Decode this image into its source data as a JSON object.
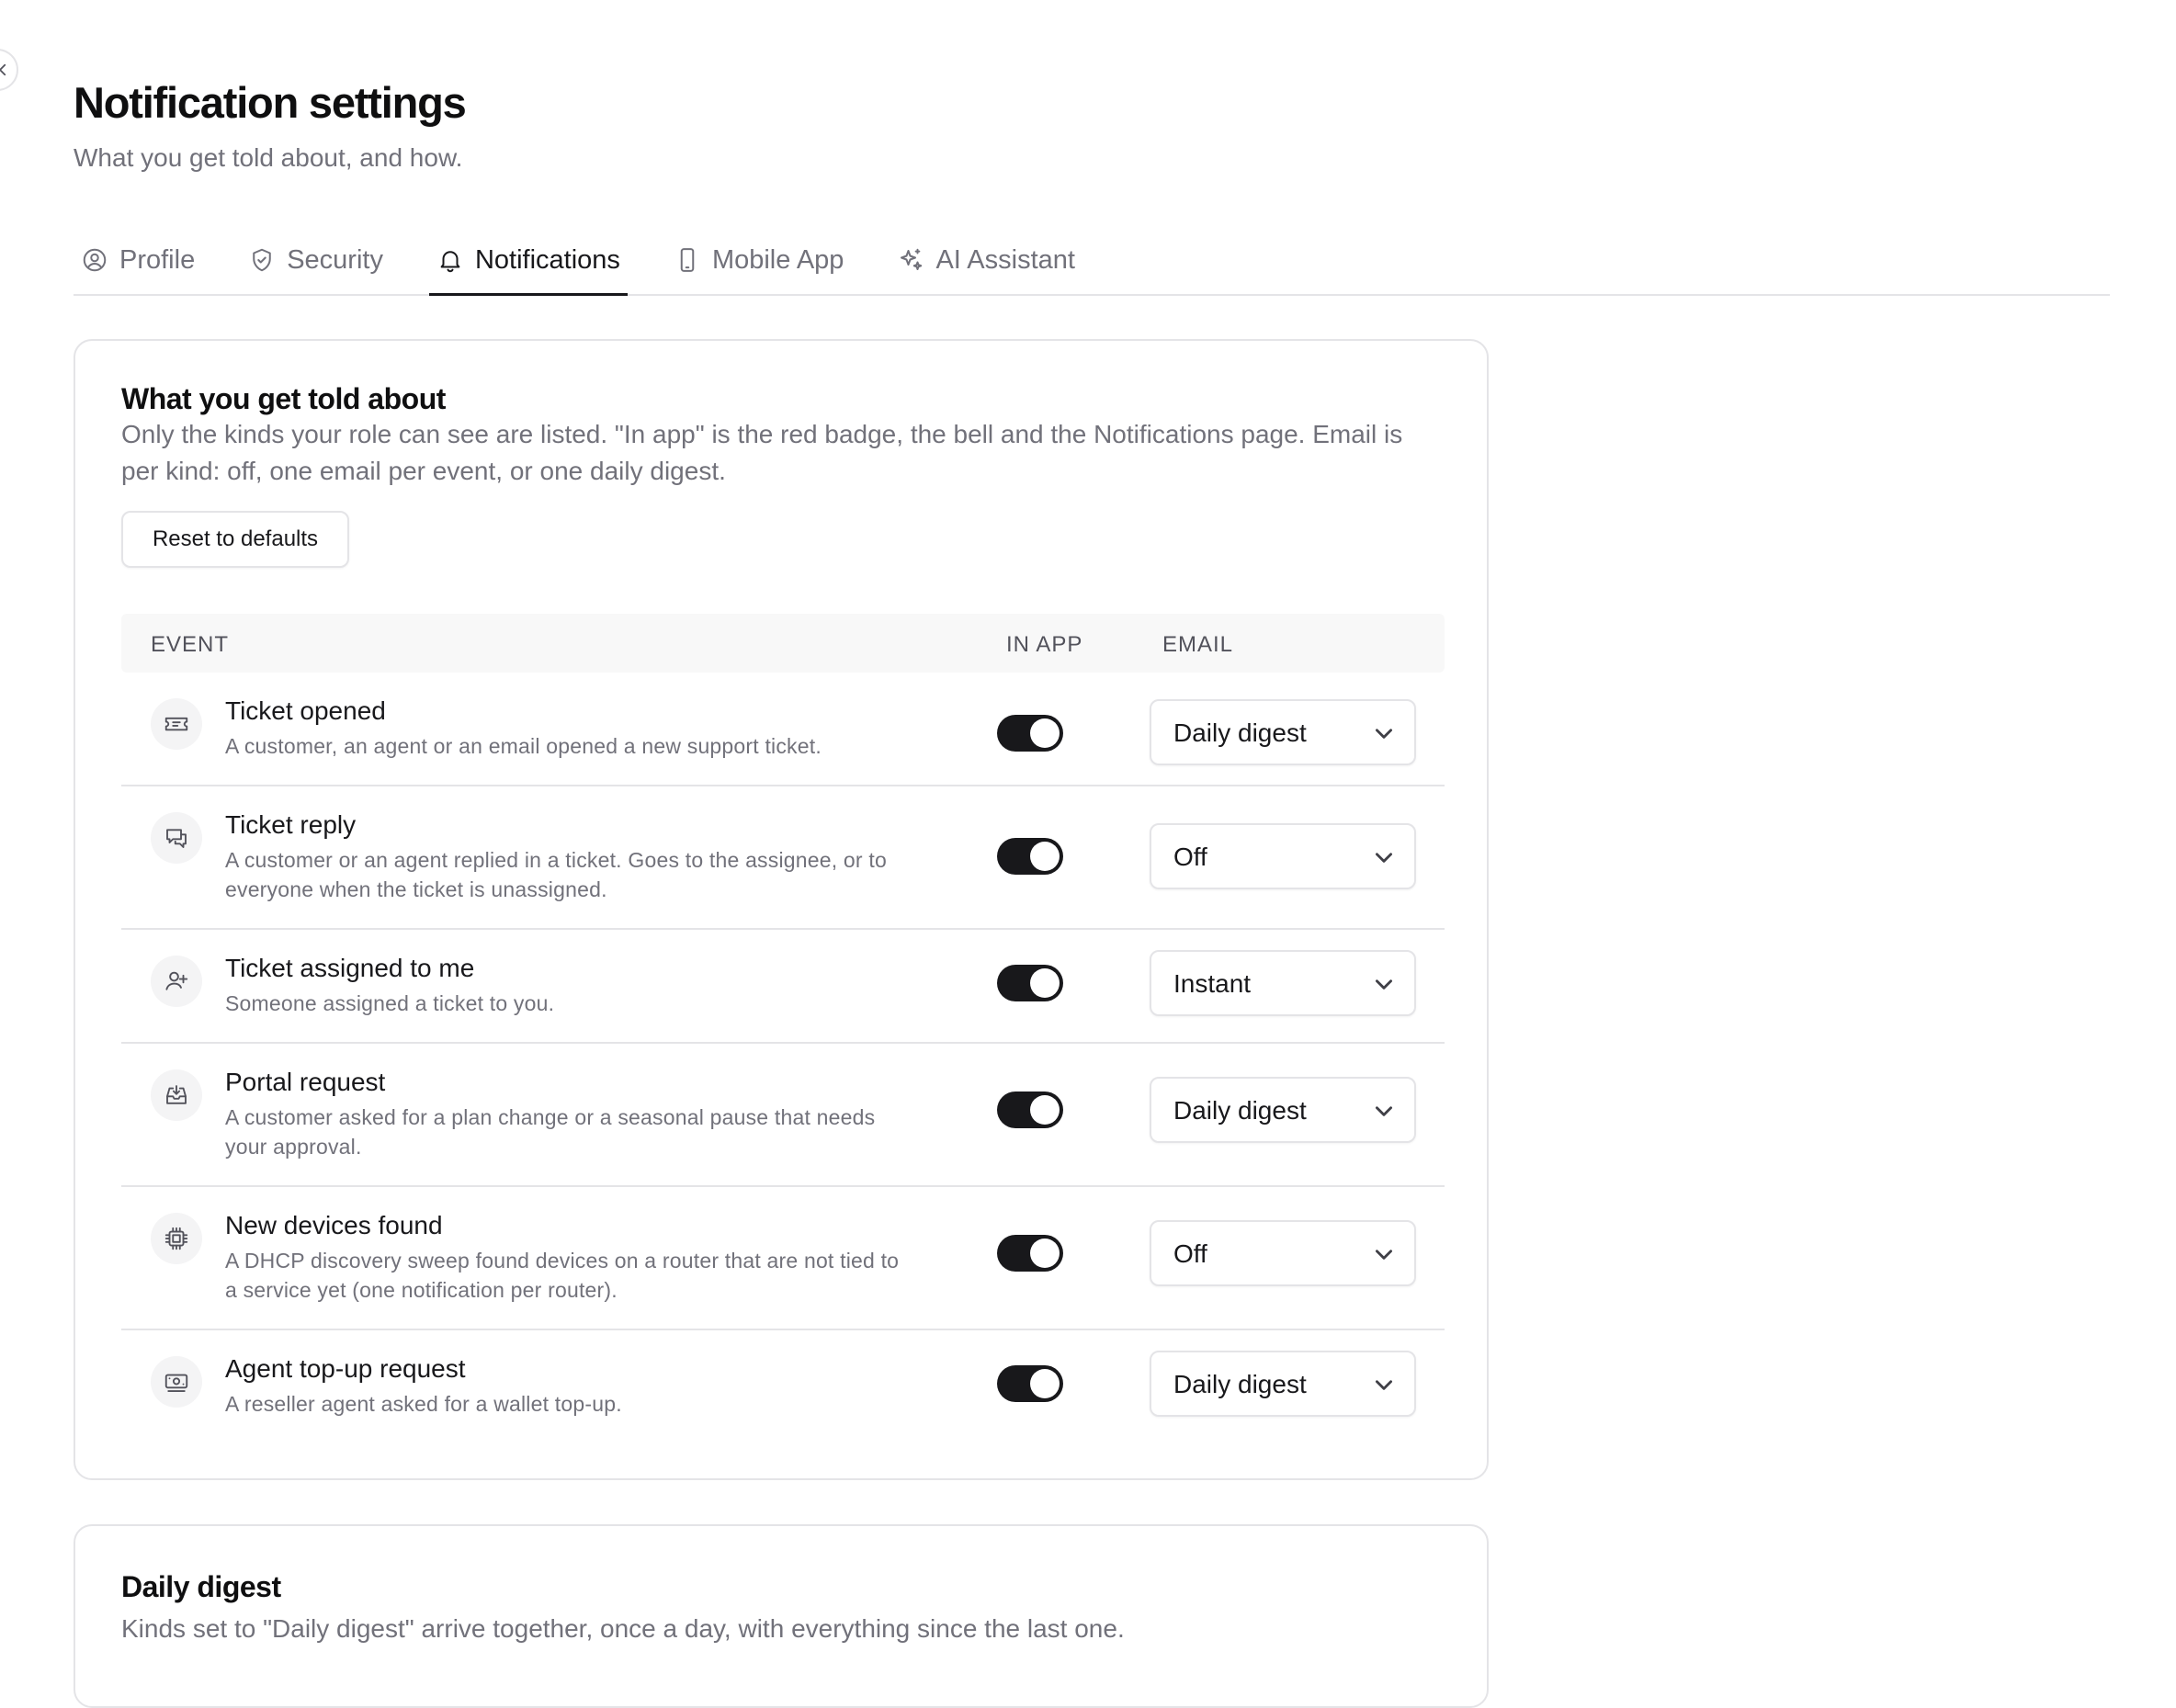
{
  "page": {
    "title": "Notification settings",
    "subtitle": "What you get told about, and how."
  },
  "tabs": [
    {
      "label": "Profile",
      "icon": "user-circle-icon",
      "active": false
    },
    {
      "label": "Security",
      "icon": "shield-check-icon",
      "active": false
    },
    {
      "label": "Notifications",
      "icon": "bell-icon",
      "active": true
    },
    {
      "label": "Mobile App",
      "icon": "smartphone-icon",
      "active": false
    },
    {
      "label": "AI Assistant",
      "icon": "sparkles-icon",
      "active": false
    }
  ],
  "told_about": {
    "title": "What you get told about",
    "description": "Only the kinds your role can see are listed. \"In app\" is the red badge, the bell and the Notifications page. Email is per kind: off, one email per event, or one daily digest.",
    "reset_label": "Reset to defaults",
    "columns": {
      "event": "EVENT",
      "in_app": "IN APP",
      "email": "EMAIL"
    },
    "events": [
      {
        "title": "Ticket opened",
        "description": "A customer, an agent or an email opened a new support ticket.",
        "icon": "ticket-icon",
        "in_app": true,
        "email": "Daily digest"
      },
      {
        "title": "Ticket reply",
        "description": "A customer or an agent replied in a ticket. Goes to the assignee, or to everyone when the ticket is unassigned.",
        "icon": "message-reply-icon",
        "in_app": true,
        "email": "Off"
      },
      {
        "title": "Ticket assigned to me",
        "description": "Someone assigned a ticket to you.",
        "icon": "user-plus-icon",
        "in_app": true,
        "email": "Instant"
      },
      {
        "title": "Portal request",
        "description": "A customer asked for a plan change or a seasonal pause that needs your approval.",
        "icon": "inbox-download-icon",
        "in_app": true,
        "email": "Daily digest"
      },
      {
        "title": "New devices found",
        "description": "A DHCP discovery sweep found devices on a router that are not tied to a service yet (one notification per router).",
        "icon": "chip-icon",
        "in_app": true,
        "email": "Off"
      },
      {
        "title": "Agent top-up request",
        "description": "A reseller agent asked for a wallet top-up.",
        "icon": "banknote-icon",
        "in_app": true,
        "email": "Daily digest"
      }
    ]
  },
  "daily_digest": {
    "title": "Daily digest",
    "description": "Kinds set to \"Daily digest\" arrive together, once a day, with everything since the last one."
  },
  "colors": {
    "accent": "#18181b",
    "muted_text": "#71717a",
    "border": "#e4e4e7"
  }
}
